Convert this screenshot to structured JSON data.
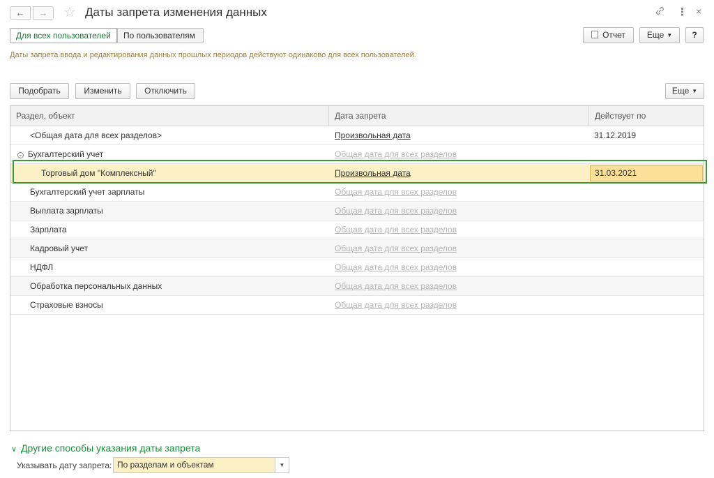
{
  "window": {
    "title": "Даты запрета изменения данных"
  },
  "nav": {
    "back_icon": "←",
    "forward_icon": "→",
    "favorite_icon": "☆",
    "link_icon": "🔗",
    "more_icon": "⋮",
    "close_icon": "×"
  },
  "tabs": [
    {
      "label": "Для всех пользователей",
      "active": true
    },
    {
      "label": "По пользователям",
      "active": false
    }
  ],
  "toolbar_top": {
    "report_label": "Отчет",
    "more_label": "Еще",
    "help_label": "?"
  },
  "hint": "Даты запрета ввода и редактирования данных прошлых периодов действуют одинаково для всех пользователей.",
  "toolbar_table": {
    "select_label": "Подобрать",
    "change_label": "Изменить",
    "disable_label": "Отключить",
    "more_label": "Еще"
  },
  "table": {
    "columns": [
      "Раздел, объект",
      "Дата запрета",
      "Действует по"
    ],
    "rows": [
      {
        "name": "<Общая дата для всех разделов>",
        "date_type": "Произвольная дата",
        "valid_until": "31.12.2019"
      },
      {
        "name": "Бухгалтерский учет",
        "date_type": "Общая дата для всех разделов",
        "valid_until": ""
      },
      {
        "name": "Торговый дом \"Комплексный\"",
        "date_type": "Произвольная дата",
        "valid_until": "31.03.2021"
      },
      {
        "name": "Бухгалтерский учет зарплаты",
        "date_type": "Общая дата для всех разделов",
        "valid_until": ""
      },
      {
        "name": "Выплата зарплаты",
        "date_type": "Общая дата для всех разделов",
        "valid_until": ""
      },
      {
        "name": "Зарплата",
        "date_type": "Общая дата для всех разделов",
        "valid_until": ""
      },
      {
        "name": "Кадровый учет",
        "date_type": "Общая дата для всех разделов",
        "valid_until": ""
      },
      {
        "name": "НДФЛ",
        "date_type": "Общая дата для всех разделов",
        "valid_until": ""
      },
      {
        "name": "Обработка персональных данных",
        "date_type": "Общая дата для всех разделов",
        "valid_until": ""
      },
      {
        "name": "Страховые взносы",
        "date_type": "Общая дата для всех разделов",
        "valid_until": ""
      }
    ]
  },
  "other_methods": {
    "title": "Другие способы указания даты запрета",
    "date_label": "Указывать дату запрета:",
    "date_value": "По разделам и объектам"
  },
  "colors": {
    "accent_green": "#1a8f3a",
    "selection_yellow": "#fcf0c6",
    "highlight_frame": "#3a9a33"
  }
}
